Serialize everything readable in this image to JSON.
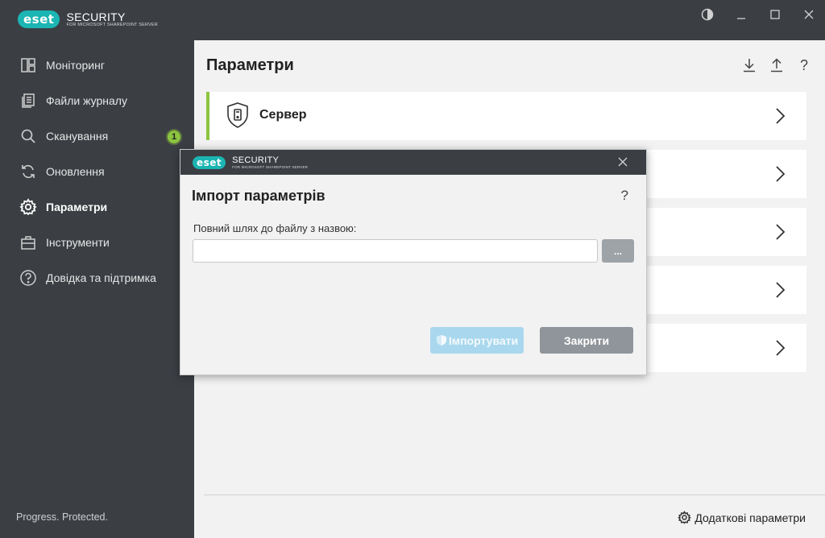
{
  "app": {
    "brand": "eset",
    "product": "SECURITY",
    "subtitle": "FOR MICROSOFT SHAREPOINT SERVER"
  },
  "window_controls": [
    "theme-icon",
    "minimize-icon",
    "maximize-icon",
    "close-icon"
  ],
  "sidebar": {
    "items": [
      {
        "label": "Моніторинг",
        "icon": "monitoring-icon"
      },
      {
        "label": "Файли журналу",
        "icon": "log-files-icon"
      },
      {
        "label": "Сканування",
        "icon": "scan-icon",
        "badge": "1"
      },
      {
        "label": "Оновлення",
        "icon": "update-icon"
      },
      {
        "label": "Параметри",
        "icon": "gear-icon",
        "active": true
      },
      {
        "label": "Інструменти",
        "icon": "toolbox-icon"
      },
      {
        "label": "Довідка та підтримка",
        "icon": "help-icon"
      }
    ],
    "footer": "Progress. Protected."
  },
  "main": {
    "title": "Параметри",
    "cards": [
      {
        "label": "Сервер",
        "icon": "server-shield-icon"
      }
    ],
    "advanced_link": "Додаткові параметри"
  },
  "modal": {
    "title": "Імпорт параметрів",
    "help": "?",
    "field_label": "Повний шлях до файлу з назвою:",
    "path_value": "",
    "browse_label": "...",
    "import_label": "Імпортувати",
    "close_label": "Закрити"
  },
  "colors": {
    "accent_green": "#8bc43f",
    "brand_teal": "#1bb5b3",
    "sidebar_bg": "#3b3f44",
    "import_disabled": "#a9d8ee"
  }
}
